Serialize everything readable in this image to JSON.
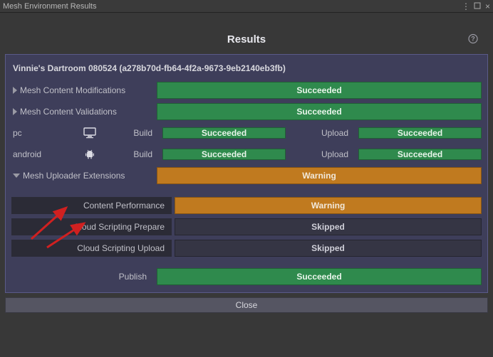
{
  "window": {
    "title": "Mesh Environment Results"
  },
  "header": {
    "title": "Results"
  },
  "project": {
    "title": "Vinnie's Dartroom 080524 (a278b70d-fb64-4f2a-9673-9eb2140eb3fb)"
  },
  "sections": {
    "modifications": {
      "label": "Mesh Content Modifications",
      "status": "Succeeded"
    },
    "validations": {
      "label": "Mesh Content Validations",
      "status": "Succeeded"
    }
  },
  "labels": {
    "build": "Build",
    "upload": "Upload",
    "publish": "Publish"
  },
  "platforms": [
    {
      "name": "pc",
      "icon": "monitor",
      "build": "Succeeded",
      "upload": "Succeeded"
    },
    {
      "name": "android",
      "icon": "android",
      "build": "Succeeded",
      "upload": "Succeeded"
    }
  ],
  "uploader_ext": {
    "label": "Mesh Uploader Extensions",
    "status": "Warning",
    "children": [
      {
        "label": "Content Performance",
        "status": "Warning"
      },
      {
        "label": "Cloud Scripting Prepare",
        "status": "Skipped"
      },
      {
        "label": "Cloud Scripting Upload",
        "status": "Skipped"
      }
    ]
  },
  "publish": {
    "status": "Succeeded"
  },
  "buttons": {
    "close": "Close"
  },
  "status_colors": {
    "Succeeded": "succ",
    "Warning": "warn",
    "Skipped": "skip"
  }
}
